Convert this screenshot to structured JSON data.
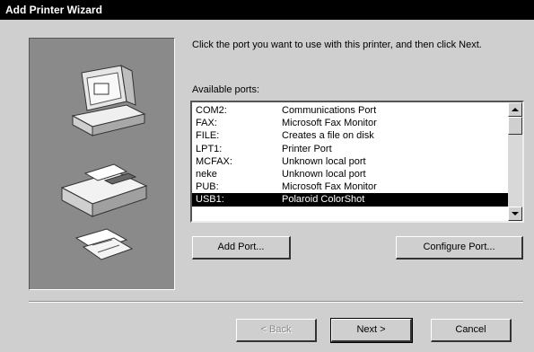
{
  "window": {
    "title": "Add Printer Wizard"
  },
  "instructions": "Click the port you want to use with this printer, and then click Next.",
  "ports_label": "Available ports:",
  "ports": [
    {
      "port": "COM2:",
      "description": "Communications Port"
    },
    {
      "port": "FAX:",
      "description": "Microsoft Fax Monitor"
    },
    {
      "port": "FILE:",
      "description": "Creates a file on disk"
    },
    {
      "port": "LPT1:",
      "description": "Printer Port"
    },
    {
      "port": "MCFAX:",
      "description": "Unknown local port"
    },
    {
      "port": "neke",
      "description": "Unknown local port"
    },
    {
      "port": "PUB:",
      "description": "Microsoft Fax Monitor"
    },
    {
      "port": "USB1:",
      "description": "Polaroid ColorShot"
    }
  ],
  "selected_port": "USB1:",
  "buttons": {
    "add_port": "Add Port...",
    "configure_port": "Configure Port...",
    "back": "< Back",
    "next": "Next >",
    "cancel": "Cancel"
  }
}
